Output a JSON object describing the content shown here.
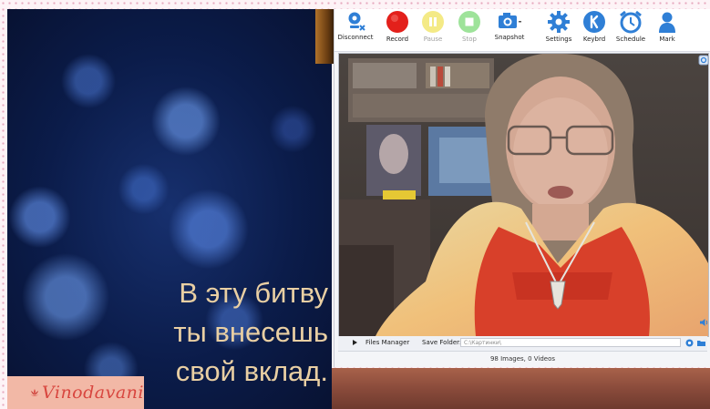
{
  "slide": {
    "caption_lines": [
      "В эту битву",
      "ты внесешь",
      "свой вклад."
    ],
    "logo_text": "Vinodavani",
    "logo_icon": "lotus-icon"
  },
  "toolbar": {
    "buttons": [
      {
        "label": "Disconnect",
        "icon": "disconnect-icon",
        "color": "#2f7fd6",
        "enabled": true
      },
      {
        "label": "Record",
        "icon": "record-icon",
        "color": "#e3201b",
        "enabled": true
      },
      {
        "label": "Pause",
        "icon": "pause-icon",
        "color": "#f4ea86",
        "enabled": false
      },
      {
        "label": "Stop",
        "icon": "stop-icon",
        "color": "#9ee39a",
        "enabled": false
      },
      {
        "label": "Snapshot",
        "icon": "camera-icon",
        "color": "#2f7fd6",
        "enabled": true
      },
      {
        "label": "Settings",
        "icon": "gear-icon",
        "color": "#2f7fd6",
        "enabled": true
      },
      {
        "label": "Keybrd",
        "icon": "keyboard-icon",
        "color": "#2f7fd6",
        "enabled": true
      },
      {
        "label": "Schedule",
        "icon": "alarm-clock-icon",
        "color": "#2f7fd6",
        "enabled": true
      },
      {
        "label": "Mark",
        "icon": "person-icon",
        "color": "#2f7fd6",
        "enabled": true
      }
    ]
  },
  "statusbar": {
    "files_manager_label": "Files Manager",
    "save_folder_label": "Save Folder:",
    "save_folder_value": "C:\\Картинки\\"
  },
  "counts_text": "98 Images, 0 Videos",
  "colors": {
    "accent": "#2f7fd6",
    "record": "#e3201b",
    "caption": "#e9cfa3",
    "logo_bg": "#f2b8a6",
    "logo_text": "#d8463f"
  }
}
